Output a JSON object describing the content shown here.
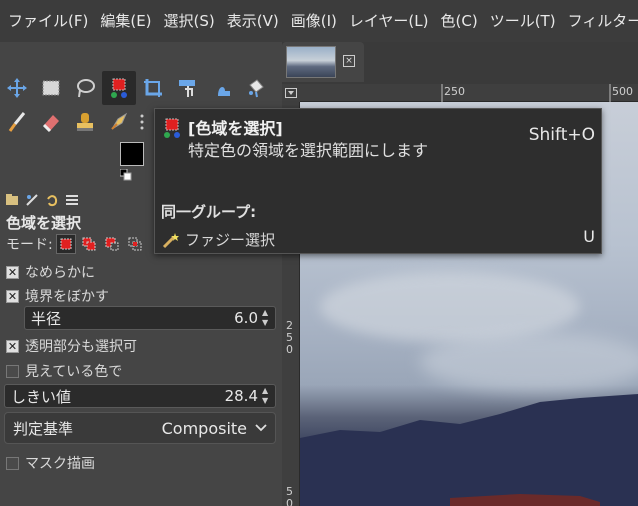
{
  "menubar": {
    "items": [
      "ファイル(F)",
      "編集(E)",
      "選択(S)",
      "表示(V)",
      "画像(I)",
      "レイヤー(L)",
      "色(C)",
      "ツール(T)",
      "フィルター(R)"
    ]
  },
  "toolbox": {
    "row1": [
      "move-tool-icon",
      "rect-select-icon",
      "free-select-icon",
      "select-by-color-icon",
      "crop-icon",
      "unified-transform-icon",
      "warp-transform-icon",
      "bucket-fill-icon"
    ],
    "row2": [
      "paintbrush-icon",
      "eraser-icon",
      "clone-icon",
      "smudge-icon"
    ]
  },
  "tool_options": {
    "title": "色域を選択",
    "mode_label": "モード:",
    "antialias_label": "なめらかに",
    "feather_label": "境界をぼかす",
    "radius_label": "半径",
    "radius_value": "6.0",
    "transparent_label": "透明部分も選択可",
    "sample_merged_label": "見えている色で",
    "threshold_label": "しきい値",
    "threshold_value": "28.4",
    "criterion_label": "判定基準",
    "criterion_value": "Composite",
    "draw_mask_label": "マスク描画"
  },
  "ruler": {
    "top_labels": [
      "250",
      "500"
    ],
    "left_labels": [
      "2\n5\n0",
      "5\n0"
    ]
  },
  "tooltip": {
    "title": "[色域を選択]",
    "description": "特定色の領域を選択範囲にします",
    "shortcut": "Shift+O",
    "group_label": "同一グループ:",
    "group_item": "ファジー選択",
    "group_item_key": "U"
  },
  "colors": {
    "accent_red": "#e02020",
    "selection_tool_bg": "#2a2a2a"
  }
}
